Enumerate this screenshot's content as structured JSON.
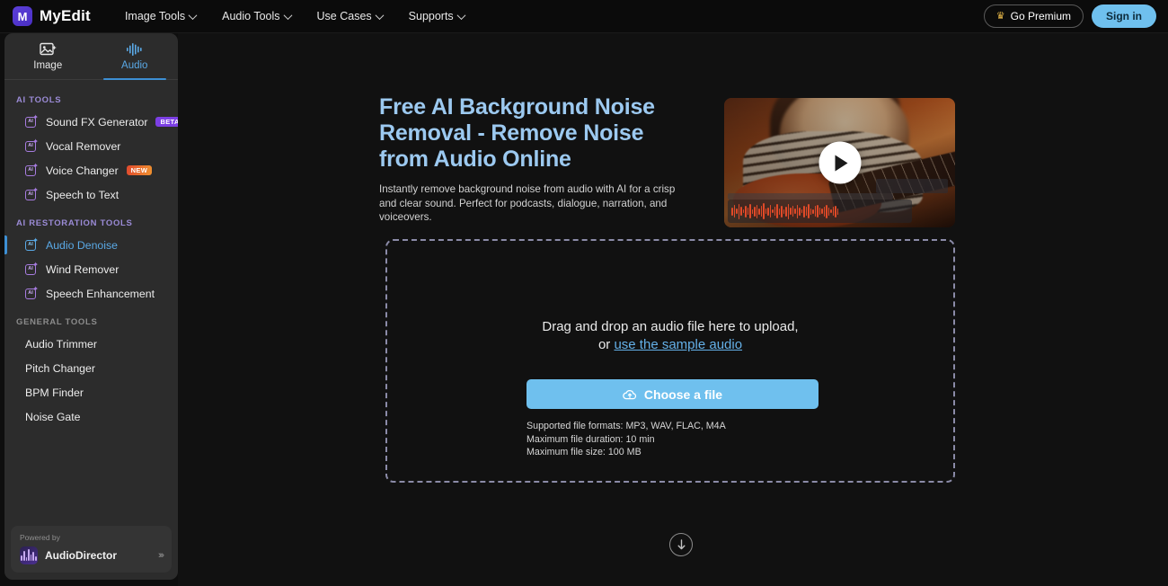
{
  "topbar": {
    "brand": {
      "mark": "M",
      "name": "MyEdit"
    },
    "nav": [
      {
        "label": "Image Tools",
        "icon": "chevron-down-icon"
      },
      {
        "label": "Audio Tools",
        "icon": "chevron-down-icon"
      },
      {
        "label": "Use Cases",
        "icon": "chevron-down-icon"
      },
      {
        "label": "Supports",
        "icon": "chevron-down-icon"
      }
    ],
    "premium_label": "Go Premium",
    "premium_icon": "crown-icon",
    "signin_label": "Sign in"
  },
  "sidebar": {
    "tabs": [
      {
        "label": "Image",
        "icon": "image-icon",
        "active": false
      },
      {
        "label": "Audio",
        "icon": "audio-waveform-icon",
        "active": true
      }
    ],
    "groups": [
      {
        "title": "AI TOOLS",
        "items": [
          {
            "label": "Sound FX Generator",
            "icon": "ai-sparkle-icon",
            "badge": "BETA",
            "badge_type": "beta"
          },
          {
            "label": "Vocal Remover",
            "icon": "ai-sparkle-icon"
          },
          {
            "label": "Voice Changer",
            "icon": "ai-sparkle-icon",
            "badge": "NEW",
            "badge_type": "new"
          },
          {
            "label": "Speech to Text",
            "icon": "ai-sparkle-icon"
          }
        ]
      },
      {
        "title": "AI RESTORATION TOOLS",
        "items": [
          {
            "label": "Audio Denoise",
            "icon": "ai-sparkle-icon",
            "active": true
          },
          {
            "label": "Wind Remover",
            "icon": "ai-sparkle-icon"
          },
          {
            "label": "Speech Enhancement",
            "icon": "ai-sparkle-icon"
          }
        ]
      },
      {
        "title": "GENERAL TOOLS",
        "items": [
          {
            "label": "Audio Trimmer"
          },
          {
            "label": "Pitch Changer"
          },
          {
            "label": "BPM Finder"
          },
          {
            "label": "Noise Gate"
          }
        ]
      }
    ],
    "powered": {
      "prefix": "Powered by",
      "name": "AudioDirector",
      "icon": "audiodirector-icon",
      "collapse_icon": "chevrons-right-icon",
      "collapse_glyph": "›››"
    }
  },
  "main": {
    "hero": {
      "title": "Free AI Background Noise Removal - Remove Noise from Audio Online",
      "description": "Instantly remove background noise from audio with AI for a crisp and clear sound. Perfect for podcasts, dialogue, narration, and voiceovers."
    },
    "video": {
      "play_icon": "play-button-icon",
      "alt": "person playing acoustic guitar"
    },
    "dropzone": {
      "line1": "Drag and drop an audio file here to upload,",
      "or_text": "or",
      "link": "use the sample audio",
      "choose_label": "Choose a file",
      "choose_icon": "cloud-upload-icon",
      "formats": "Supported file formats: MP3, WAV, FLAC, M4A",
      "duration": "Maximum file duration: 10 min",
      "size": "Maximum file size: 100 MB"
    },
    "scroll_icon": "arrow-down-circle-icon"
  },
  "colors": {
    "accent_blue": "#6fc0ee",
    "heading_blue": "#9cc9f0",
    "badge_beta": "#7c3fe4",
    "badge_new": "#e0492e",
    "brand_purple": "#5b3fd8"
  }
}
